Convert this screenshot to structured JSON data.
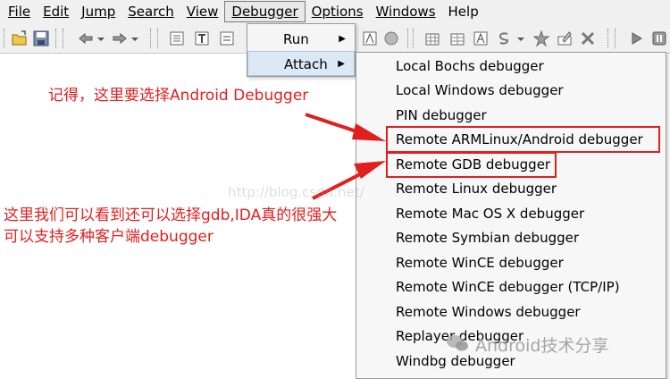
{
  "menubar": {
    "items": [
      {
        "label": "File",
        "key": "file"
      },
      {
        "label": "Edit",
        "key": "edit"
      },
      {
        "label": "Jump",
        "key": "jump"
      },
      {
        "label": "Search",
        "key": "search"
      },
      {
        "label": "View",
        "key": "view"
      },
      {
        "label": "Debugger",
        "key": "debugger"
      },
      {
        "label": "Options",
        "key": "options"
      },
      {
        "label": "Windows",
        "key": "windows"
      },
      {
        "label": "Help",
        "key": "help"
      }
    ]
  },
  "debugger_menu": {
    "run_label": "Run",
    "attach_label": "Attach"
  },
  "attach_submenu": {
    "items": [
      "Local Bochs debugger",
      "Local Windows debugger",
      "PIN debugger",
      "Remote ARMLinux/Android debugger",
      "Remote GDB debugger",
      "Remote Linux debugger",
      "Remote Mac OS X debugger",
      "Remote Symbian debugger",
      "Remote WinCE debugger",
      "Remote WinCE debugger (TCP/IP)",
      "Remote Windows debugger",
      "Replayer debugger",
      "Windbg debugger"
    ]
  },
  "annotations": {
    "note_android": "记得，这里要选择Android Debugger",
    "note_gdb_line1": "这里我们可以看到还可以选择gdb,IDA真的很强大",
    "note_gdb_line2": "可以支持多种客户端debugger"
  },
  "watermark": {
    "text": "Android技术分享",
    "faint_text": "http://blog.csdn.net/"
  },
  "colors": {
    "annotation_red": "#e02020",
    "menu_bg": "#f0f0f0"
  }
}
